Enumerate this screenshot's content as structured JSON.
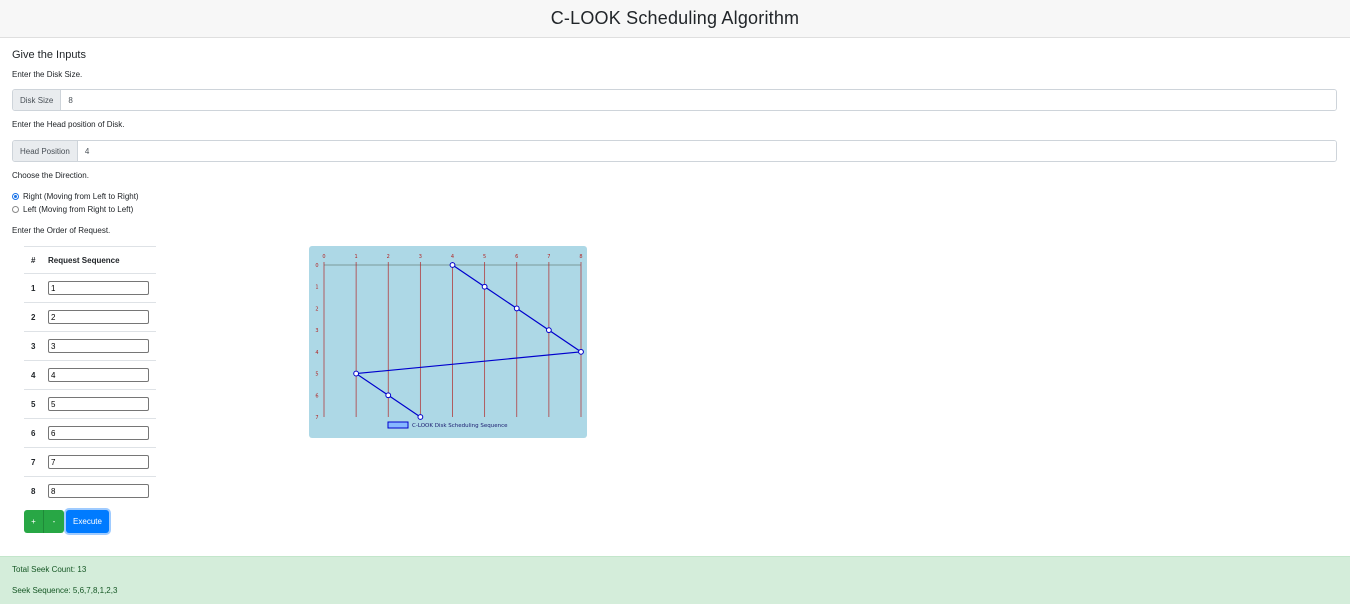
{
  "header": {
    "title": "C-LOOK Scheduling Algorithm"
  },
  "inputs": {
    "section_title": "Give the Inputs",
    "disk_size_hint": "Enter the Disk Size.",
    "disk_size_label": "Disk Size",
    "disk_size_value": "8",
    "head_hint": "Enter the Head position of Disk.",
    "head_label": "Head Position",
    "head_value": "4",
    "direction_hint": "Choose the Direction.",
    "direction_options": [
      {
        "label": "Right (Moving from Left to Right)",
        "selected": true
      },
      {
        "label": "Left (Moving from Right to Left)",
        "selected": false
      }
    ],
    "order_hint": "Enter the Order of Request."
  },
  "table": {
    "headers": [
      "#",
      "Request Sequence"
    ],
    "rows": [
      {
        "index": "1",
        "value": "1"
      },
      {
        "index": "2",
        "value": "2"
      },
      {
        "index": "3",
        "value": "3"
      },
      {
        "index": "4",
        "value": "4"
      },
      {
        "index": "5",
        "value": "5"
      },
      {
        "index": "6",
        "value": "6"
      },
      {
        "index": "7",
        "value": "7"
      },
      {
        "index": "8",
        "value": "8"
      }
    ]
  },
  "buttons": {
    "add_label": "+",
    "remove_label": "-",
    "execute_label": "Execute"
  },
  "chart_data": {
    "type": "line",
    "legend": "C-LOOK Disk Scheduling Sequence",
    "x_ticks": [
      0,
      1,
      2,
      3,
      4,
      5,
      6,
      7,
      8
    ],
    "y_ticks": [
      0,
      1,
      2,
      3,
      4,
      5,
      6,
      7
    ],
    "series": [
      {
        "name": "C-LOOK Disk Scheduling Sequence",
        "points": [
          [
            4,
            0
          ],
          [
            5,
            1
          ],
          [
            6,
            2
          ],
          [
            7,
            3
          ],
          [
            8,
            4
          ],
          [
            1,
            5
          ],
          [
            2,
            6
          ],
          [
            3,
            7
          ]
        ]
      }
    ],
    "colors": {
      "background": "#add8e6",
      "line": "#0000cd",
      "grid": "#b22222",
      "tick_text": "#b22222"
    }
  },
  "result": {
    "seek_count": "Total Seek Count: 13",
    "seek_sequence": "Seek Sequence: 5,6,7,8,1,2,3"
  }
}
